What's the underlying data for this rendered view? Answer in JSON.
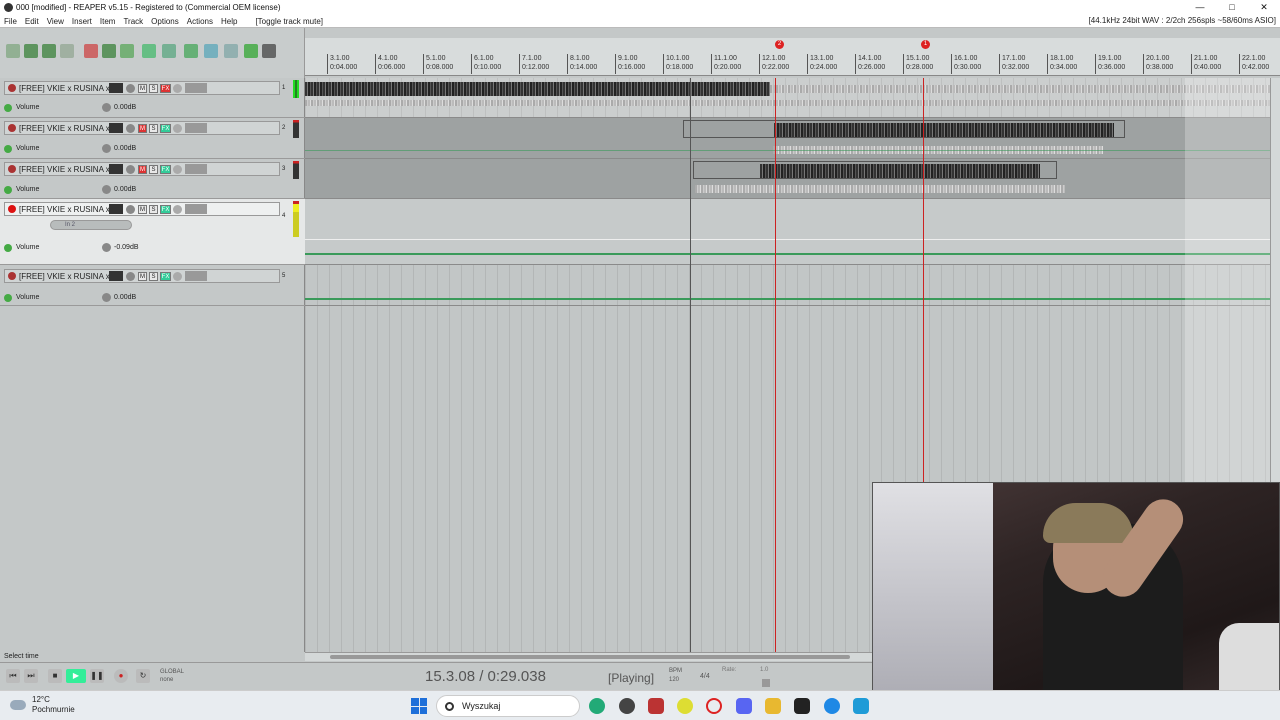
{
  "window": {
    "title": "000 [modified] - REAPER v5.15 - Registered to  (Commercial OEM license)",
    "controls": [
      "—",
      "□",
      "✕"
    ]
  },
  "menu": {
    "items": [
      "File",
      "Edit",
      "View",
      "Insert",
      "Item",
      "Track",
      "Options",
      "Actions",
      "Help",
      "[Toggle track mute]"
    ],
    "audio_status": "[44.1kHz 24bit WAV : 2/2ch 256spls ~58/60ms ASIO]"
  },
  "ruler": {
    "measures": [
      "3.1.00",
      "4.1.00",
      "5.1.00",
      "6.1.00",
      "7.1.00",
      "8.1.00",
      "9.1.00",
      "10.1.00",
      "11.1.00",
      "12.1.00",
      "13.1.00",
      "14.1.00",
      "15.1.00",
      "16.1.00",
      "17.1.00",
      "18.1.00",
      "19.1.00",
      "20.1.00",
      "21.1.00",
      "22.1.00"
    ],
    "times": [
      "0:04.000",
      "0:06.000",
      "0:08.000",
      "0:10.000",
      "0:12.000",
      "0:14.000",
      "0:16.000",
      "0:18.000",
      "0:20.000",
      "0:22.000",
      "0:24.000",
      "0:26.000",
      "0:28.000",
      "0:30.000",
      "0:32.000",
      "0:34.000",
      "0:36.000",
      "0:38.000",
      "0:40.000",
      "0:42.000"
    ],
    "markers": [
      "2",
      "1"
    ]
  },
  "tracks": [
    {
      "name": "[FREE] VKIE x RUSINA x YE",
      "volume_label": "Volume",
      "volume_value": "0.00dB",
      "number": "1",
      "mute": "M",
      "solo": "S",
      "fx": "FX"
    },
    {
      "name": "[FREE] VKIE x RUSINA x YE",
      "volume_label": "Volume",
      "volume_value": "0.00dB",
      "number": "2",
      "mute": "M",
      "solo": "S",
      "fx": "FX"
    },
    {
      "name": "[FREE] VKIE x RUSINA x YE",
      "volume_label": "Volume",
      "volume_value": "0.00dB",
      "number": "3",
      "mute": "M",
      "solo": "S",
      "fx": "FX"
    },
    {
      "name": "[FREE] VKIE x RUSINA x YE",
      "volume_label": "Volume",
      "volume_value": "-0.09dB",
      "number": "4",
      "mute": "M",
      "solo": "S",
      "fx": "FX",
      "input": "In 2"
    },
    {
      "name": "[FREE] VKIE x RUSINA x YE",
      "volume_label": "Volume",
      "volume_value": "0.00dB",
      "number": "5",
      "mute": "M",
      "solo": "S",
      "fx": "FX"
    }
  ],
  "status_bar": {
    "text": "Select time"
  },
  "transport": {
    "position": "15.3.08 / 0:29.038",
    "state": "[Playing]",
    "bpm_label": "BPM",
    "bpm": "120",
    "time_signature": "4/4",
    "rate_label": "Rate:",
    "rate": "1.0",
    "global_label": "GLOBAL",
    "global_value": "none"
  },
  "taskbar": {
    "temperature": "12°C",
    "weather": "Pochmurnie",
    "search_placeholder": "Wyszukaj"
  },
  "colors": {
    "record": "#d11111",
    "play_cursor": "#cc2222",
    "envelope": "#3a9a5a",
    "fx_active": "#33cc99"
  }
}
